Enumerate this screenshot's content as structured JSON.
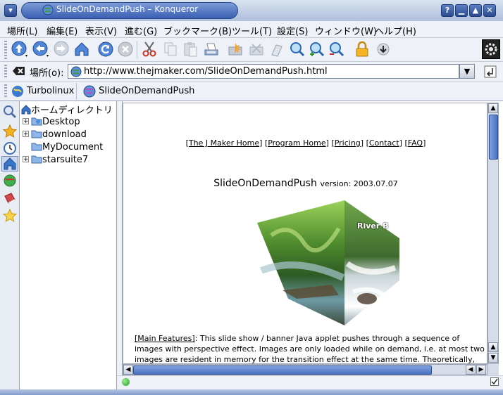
{
  "window": {
    "title": "SlideOnDemandPush – Konqueror"
  },
  "menubar": [
    "場所(L)",
    "編集(E)",
    "表示(V)",
    "進む(G)",
    "ブックマーク(B)",
    "ツール(T)",
    "設定(S)",
    "ウィンドウ(W)",
    "ヘルプ(H)"
  ],
  "locationbar": {
    "label": "場所(o):",
    "url": "http://www.thejmaker.com/SlideOnDemandPush.html"
  },
  "bookmarks": [
    {
      "label": "Turbolinux"
    },
    {
      "label": "SlideOnDemandPush"
    }
  ],
  "tree": {
    "root": "ホームディレクトリ",
    "items": [
      "Desktop",
      "download",
      "MyDocument",
      "starsuite7"
    ]
  },
  "page": {
    "nav": [
      "The J Maker Home",
      "Program Home",
      "Pricing",
      "Contact",
      "FAQ"
    ],
    "applet_name": "SlideOnDemandPush",
    "version": "version: 2003.07.07",
    "cube_caption": "River B",
    "features_heading": "[Main Features]",
    "features_text": ": This slide show / banner Java applet pushes through a sequence of images with perspective effect. Images are only loaded while on demand, i.e. at most two images are resident in memory for the transition effect at the same time. Theoretically, unlimited number of images can be"
  },
  "colors": {
    "window_frame": "#3a60b3",
    "chrome": "#eef1f7",
    "accent": "#4a72c0"
  }
}
